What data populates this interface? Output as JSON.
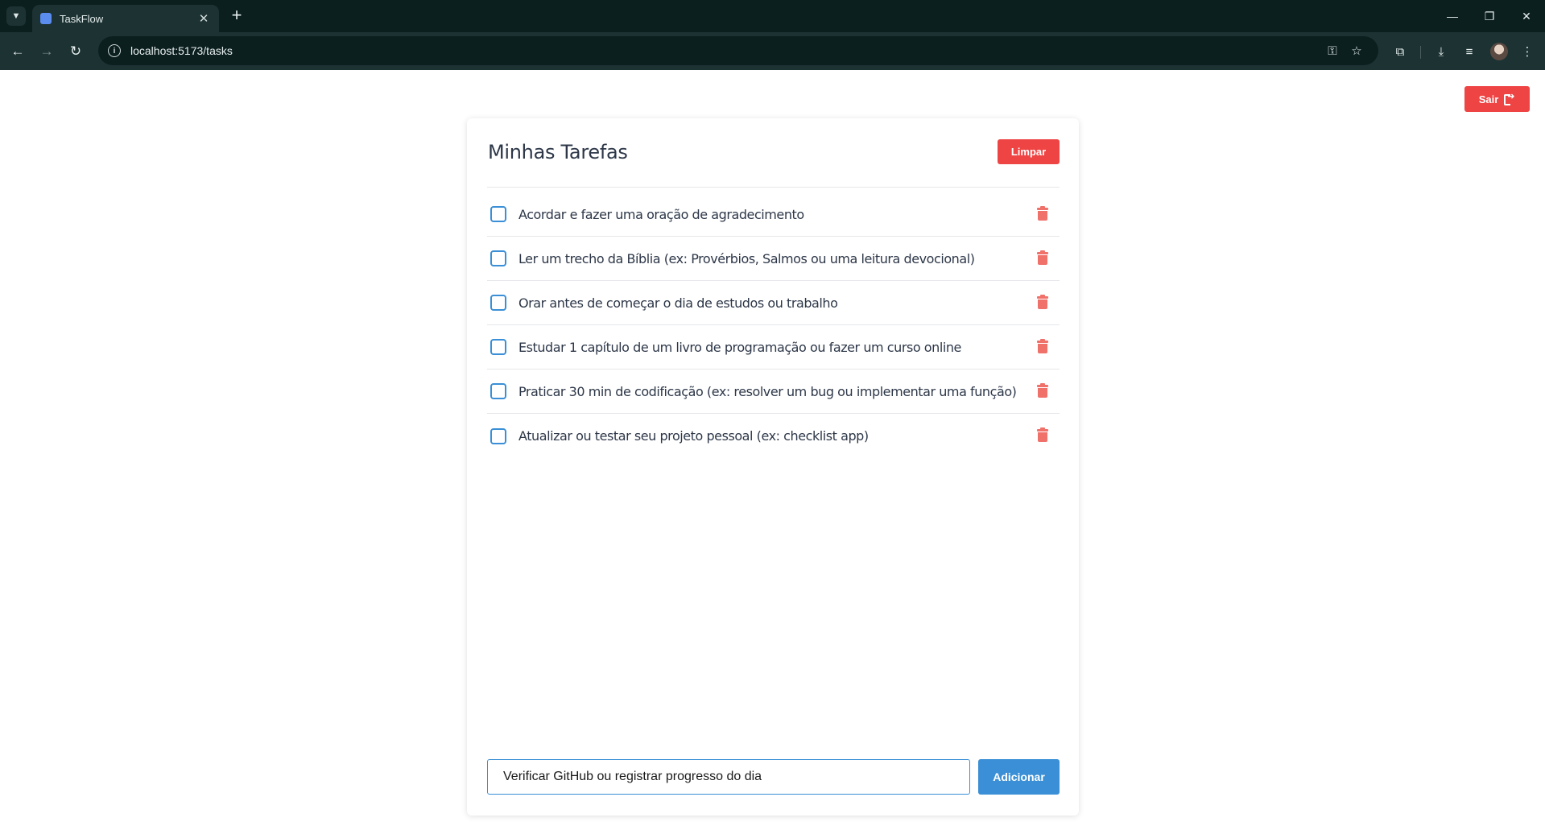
{
  "browser": {
    "tab_title": "TaskFlow",
    "url": "localhost:5173/tasks",
    "icons": {
      "tab_menu": "chevron-down-icon",
      "new_tab": "plus-icon",
      "back": "arrow-left-icon",
      "forward": "arrow-right-icon",
      "reload": "reload-icon",
      "site_info": "info-icon",
      "password": "key-icon",
      "bookmark": "star-icon",
      "extensions": "puzzle-icon",
      "downloads": "download-icon",
      "reading_list": "reading-list-icon",
      "menu": "kebab-menu-icon"
    }
  },
  "header": {
    "logout_label": "Sair"
  },
  "card": {
    "title": "Minhas Tarefas",
    "clear_label": "Limpar"
  },
  "tasks": [
    {
      "text": "Acordar e fazer uma oração de agradecimento",
      "done": false
    },
    {
      "text": "Ler um trecho da Bíblia (ex: Provérbios, Salmos ou uma leitura devocional)",
      "done": false
    },
    {
      "text": "Orar antes de começar o dia de estudos ou trabalho",
      "done": false
    },
    {
      "text": "Estudar 1 capítulo de um livro de programação ou fazer um curso online",
      "done": false
    },
    {
      "text": "Praticar 30 min de codificação (ex: resolver um bug ou implementar uma função)",
      "done": false
    },
    {
      "text": "Atualizar ou testar seu projeto pessoal (ex: checklist app)",
      "done": false
    }
  ],
  "new_task": {
    "value": "Verificar GitHub ou registrar progresso do dia",
    "add_label": "Adicionar"
  },
  "colors": {
    "danger": "#ef4444",
    "primary": "#3a8fd6",
    "trash": "#f0706a"
  }
}
